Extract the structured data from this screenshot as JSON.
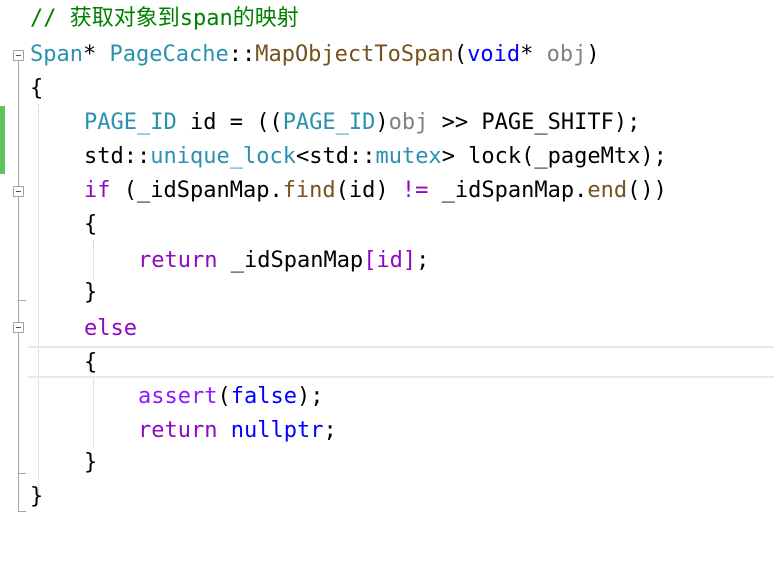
{
  "lines": {
    "l1": {
      "comment": "// 获取对象到span的映射"
    },
    "l2": {
      "ret_type": "Span",
      "star": "*",
      "class_name": "PageCache",
      "scope": "::",
      "method": "MapObjectToSpan",
      "open": "(",
      "ptype": "void",
      "pstar": "*",
      "pname": "obj",
      "close": ")"
    },
    "l3": {
      "brace": "{"
    },
    "l4": {
      "type1": "PAGE_ID",
      "var": " id = ((",
      "type2": "PAGE_ID",
      "cast_close": ")",
      "obj": "obj",
      "rest": " >> PAGE_SHITF);"
    },
    "l5": {
      "ns": "std",
      "scope1": "::",
      "lock_type": "unique_lock",
      "lt": "<",
      "ns2": "std",
      "scope2": "::",
      "mutex": "mutex",
      "gt": ">",
      "rest": " lock(_pageMtx);"
    },
    "l6": {
      "kw_if": "if",
      "p1": " (_idSpanMap.",
      "find": "find",
      "p2": "(id) ",
      "neq": "!=",
      "p3": " _idSpanMap.",
      "end": "end",
      "p4": "())"
    },
    "l7": {
      "brace": "{"
    },
    "l8": {
      "kw_return": "return",
      "p1": " _idSpanMap",
      "bracket": "[id]",
      "semi": ";"
    },
    "l9": {
      "brace": "}"
    },
    "l10": {
      "kw_else": "else"
    },
    "l11": {
      "brace": "{"
    },
    "l12": {
      "assert": "assert",
      "open": "(",
      "false": "false",
      "close": ");"
    },
    "l13": {
      "kw_return": "return",
      "sp": " ",
      "nullptr": "nullptr",
      "semi": ";"
    },
    "l14": {
      "brace": "}"
    },
    "l15": {
      "brace": "}"
    }
  }
}
